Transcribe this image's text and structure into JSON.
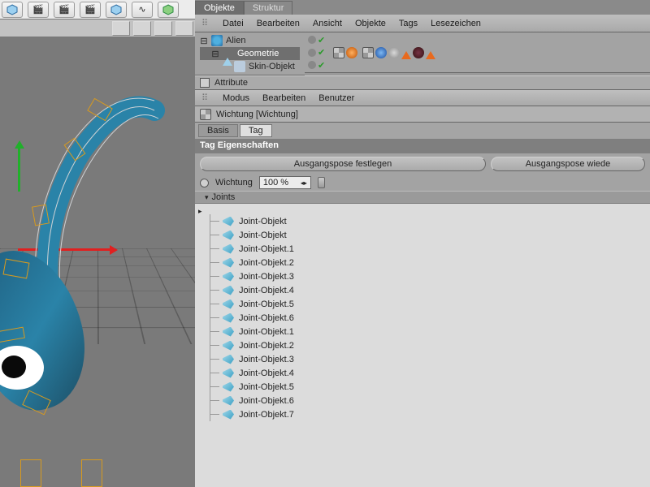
{
  "panel_tabs": [
    "Objekte",
    "Struktur"
  ],
  "active_panel_tab": 0,
  "obj_menu": [
    "Datei",
    "Bearbeiten",
    "Ansicht",
    "Objekte",
    "Tags",
    "Lesezeichen"
  ],
  "tree": {
    "items": [
      {
        "name": "Alien",
        "indent": 0,
        "sel": false,
        "icon": "i-null",
        "expander": "⊟"
      },
      {
        "name": "Geometrie",
        "indent": 1,
        "sel": true,
        "icon": "i-geo",
        "expander": "⊟"
      },
      {
        "name": "Skin-Objekt",
        "indent": 2,
        "sel": false,
        "icon": "i-skin",
        "expander": ""
      }
    ]
  },
  "attribute_title": "Attribute",
  "attr_menu": [
    "Modus",
    "Bearbeiten",
    "Benutzer"
  ],
  "wichtung_header": "Wichtung [Wichtung]",
  "subtabs": [
    "Basis",
    "Tag"
  ],
  "active_subtab": 1,
  "section_title": "Tag Eigenschaften",
  "buttons": {
    "set": "Ausgangspose festlegen",
    "restore": "Ausgangspose wiede"
  },
  "wichtung_label": "Wichtung",
  "wichtung_value": "100 %",
  "joints_label": "Joints",
  "joints": [
    "Joint-Objekt",
    "Joint-Objekt",
    "Joint-Objekt.1",
    "Joint-Objekt.2",
    "Joint-Objekt.3",
    "Joint-Objekt.4",
    "Joint-Objekt.5",
    "Joint-Objekt.6",
    "Joint-Objekt.1",
    "Joint-Objekt.2",
    "Joint-Objekt.3",
    "Joint-Objekt.4",
    "Joint-Objekt.5",
    "Joint-Objekt.6",
    "Joint-Objekt.7"
  ]
}
